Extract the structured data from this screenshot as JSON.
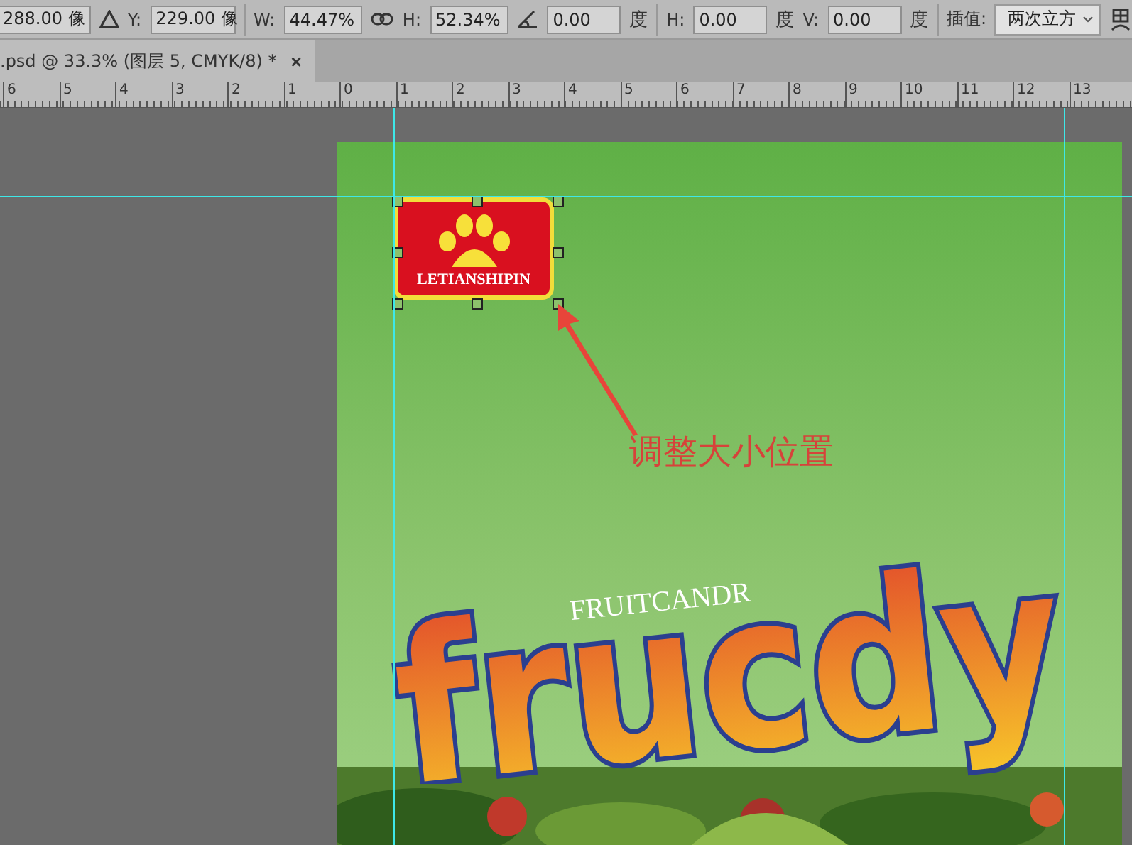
{
  "options_bar": {
    "items": [
      {
        "kind": "field",
        "value": "288.00 像"
      },
      {
        "kind": "reference"
      },
      {
        "kind": "label",
        "text": "Y:"
      },
      {
        "kind": "field",
        "value": "229.00 像"
      },
      {
        "kind": "separator"
      },
      {
        "kind": "label",
        "text": "W:"
      },
      {
        "kind": "field",
        "value": "44.47%"
      },
      {
        "kind": "link"
      },
      {
        "kind": "label",
        "text": "H:"
      },
      {
        "kind": "field",
        "value": "52.34%"
      },
      {
        "kind": "angle"
      },
      {
        "kind": "field",
        "value": "0.00"
      },
      {
        "kind": "unit",
        "text": "度"
      },
      {
        "kind": "separator"
      },
      {
        "kind": "label",
        "text": "H:"
      },
      {
        "kind": "field",
        "value": "0.00"
      },
      {
        "kind": "unit",
        "text": "度"
      },
      {
        "kind": "label",
        "text": "V:"
      },
      {
        "kind": "field",
        "value": "0.00"
      },
      {
        "kind": "unit",
        "text": "度"
      },
      {
        "kind": "separator"
      },
      {
        "kind": "label",
        "text": "插值:"
      },
      {
        "kind": "dropdown",
        "value": "两次立方"
      },
      {
        "kind": "warp"
      }
    ]
  },
  "tab": {
    "title": ".psd @ 33.3% (图层 5, CMYK/8) *",
    "close": "×"
  },
  "ruler": {
    "labels": [
      "6",
      "5",
      "4",
      "3",
      "2",
      "1",
      "0",
      "1",
      "2",
      "3",
      "4",
      "5",
      "6",
      "7",
      "8",
      "9",
      "10",
      "11",
      "12",
      "13"
    ]
  },
  "canvas": {
    "logo_text": "LETIANSHIPIN",
    "subtitle": "FRUITCANDR",
    "title": "frucdy",
    "annotation": "调整大小位置"
  }
}
